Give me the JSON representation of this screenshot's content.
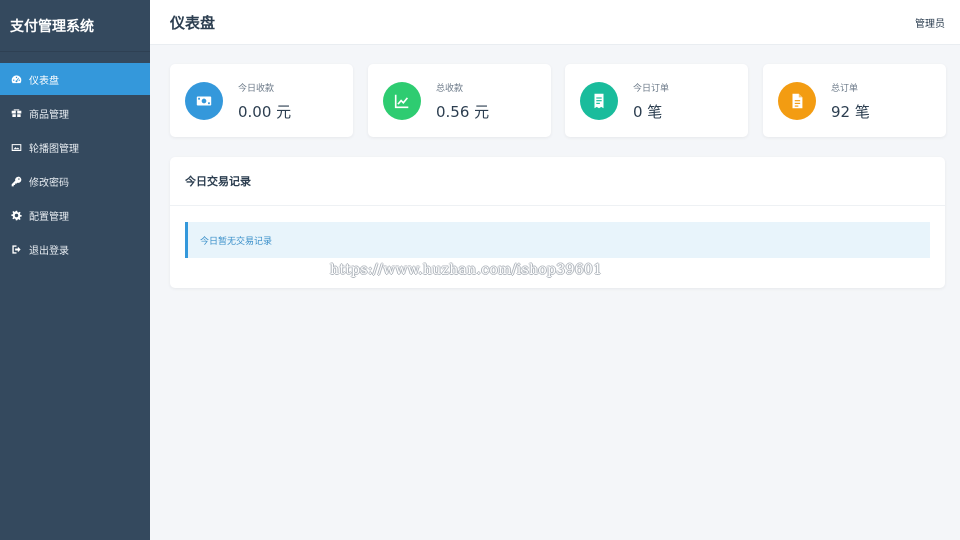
{
  "app": {
    "title": "支付管理系统"
  },
  "sidebar": {
    "items": [
      {
        "label": "仪表盘",
        "icon": "dashboard-icon",
        "active": true
      },
      {
        "label": "商品管理",
        "icon": "products-icon",
        "active": false
      },
      {
        "label": "轮播图管理",
        "icon": "image-icon",
        "active": false
      },
      {
        "label": "修改密码",
        "icon": "key-icon",
        "active": false
      },
      {
        "label": "配置管理",
        "icon": "gear-icon",
        "active": false
      },
      {
        "label": "退出登录",
        "icon": "logout-icon",
        "active": false
      }
    ]
  },
  "header": {
    "title": "仪表盘",
    "user": "管理员"
  },
  "stats": [
    {
      "label": "今日收款",
      "value": "0.00 元",
      "icon": "money-icon",
      "color": "#3498db"
    },
    {
      "label": "总收款",
      "value": "0.56 元",
      "icon": "chart-line-icon",
      "color": "#2ecc71"
    },
    {
      "label": "今日订单",
      "value": "0 笔",
      "icon": "receipt-icon",
      "color": "#1abc9c"
    },
    {
      "label": "总订单",
      "value": "92 笔",
      "icon": "document-icon",
      "color": "#f39c12"
    }
  ],
  "transactions": {
    "title": "今日交易记录",
    "empty_message": "今日暂无交易记录"
  },
  "watermark": "https://www.huzhan.com/ishop39601",
  "colors": {
    "sidebar_bg": "#34495e",
    "accent": "#3498db",
    "page_bg": "#f4f6f9"
  }
}
